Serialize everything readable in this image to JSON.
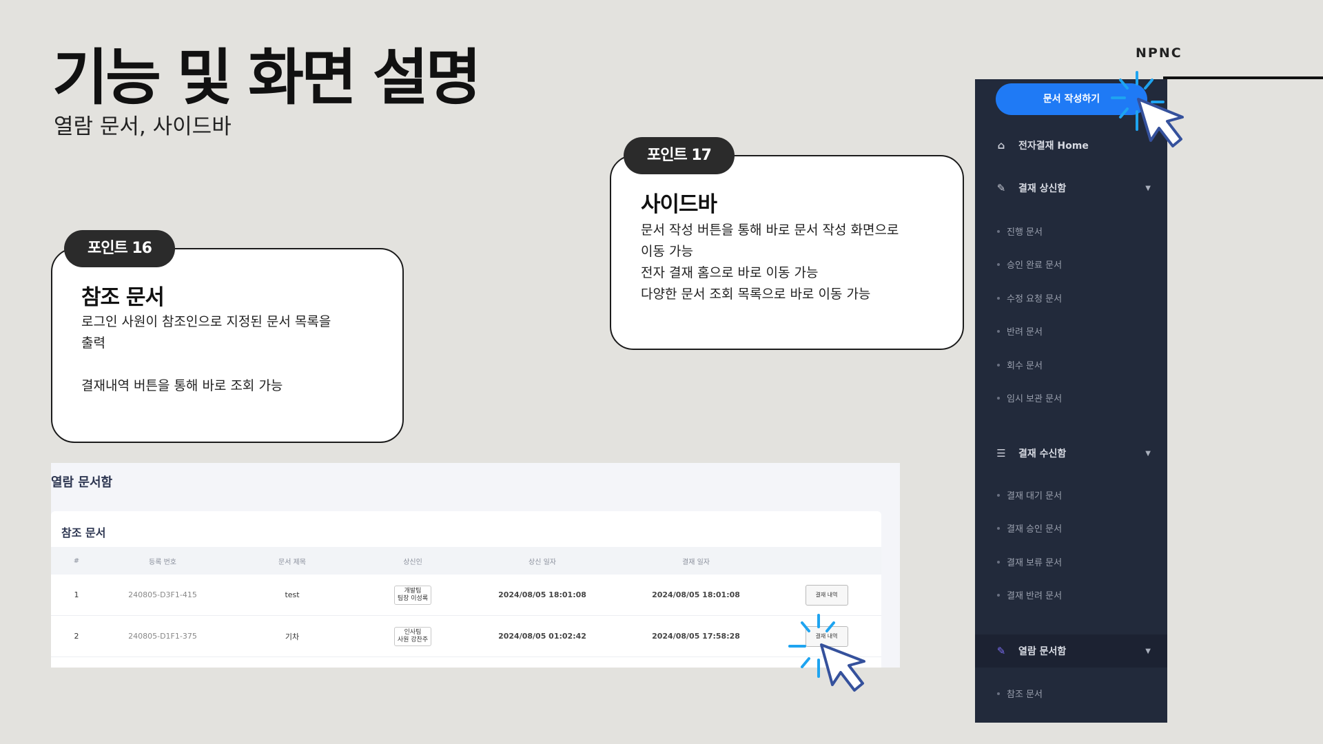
{
  "header": {
    "title": "기능 및 화면 설명",
    "subtitle": "열람 문서, 사이드바",
    "brand": "NPNC"
  },
  "card16": {
    "pill": "포인트 16",
    "heading": "참조 문서",
    "description": "로그인 사원이 참조인으로 지정된 문서 목록을\n출력\n\n결재내역 버튼을 통해 바로 조회 가능"
  },
  "card17": {
    "pill": "포인트 17",
    "heading": "사이드바",
    "description": "문서 작성 버튼을 통해 바로 문서 작성 화면으로\n이동 가능\n전자 결재 홈으로 바로 이동 가능\n다양한 문서 조회 목록으로 바로 이동 가능"
  },
  "panel": {
    "title": "열람 문서함",
    "section": "참조 문서",
    "columns": [
      "#",
      "등록 번호",
      "문서 제목",
      "상신인",
      "상신 일자",
      "결재 일자",
      ""
    ],
    "rows": [
      {
        "no": "1",
        "reg": "240805-D3F1-415",
        "title": "test",
        "sender": "개발팀\n팀장 이성록",
        "sent": "2024/08/05 18:01:08",
        "approved": "2024/08/05 18:01:08",
        "action": "결재 내역"
      },
      {
        "no": "2",
        "reg": "240805-D1F1-375",
        "title": "기차",
        "sender": "인사팀\n사원 강찬주",
        "sent": "2024/08/05 01:02:42",
        "approved": "2024/08/05 17:58:28",
        "action": "결재 내역"
      }
    ]
  },
  "sidebar": {
    "write_button": "문서 작성하기",
    "home": "전자결재 Home",
    "group1": "결재 상신함",
    "group1_items": [
      "진행 문서",
      "승인 완료 문서",
      "수정 요청 문서",
      "반려 문서",
      "회수 문서",
      "임시 보관 문서"
    ],
    "group2": "결재 수신함",
    "group2_items": [
      "결재 대기 문서",
      "결재 승인 문서",
      "결재 보류 문서",
      "결재 반려 문서"
    ],
    "group3": "열람 문서함",
    "group3_items": [
      "참조 문서"
    ]
  }
}
